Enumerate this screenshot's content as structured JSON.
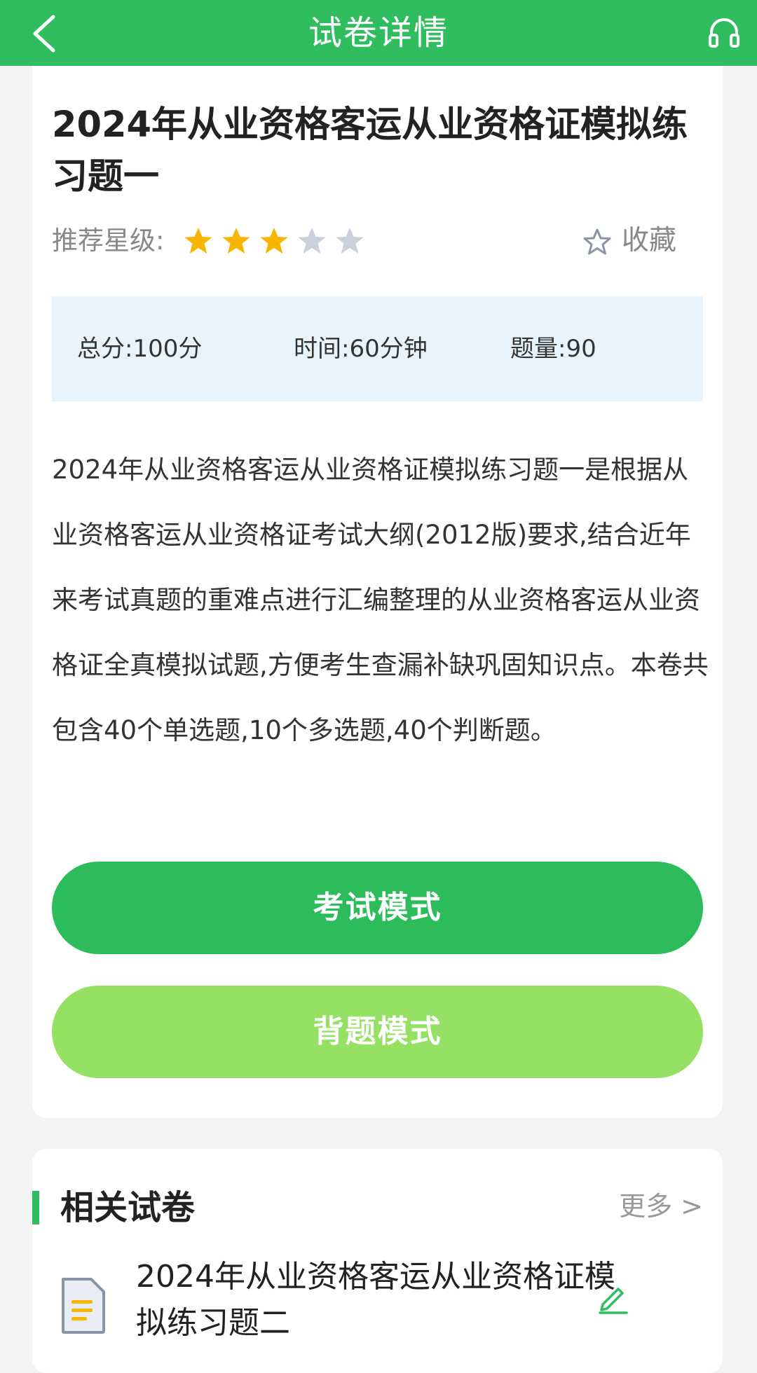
{
  "header": {
    "title": "试卷详情",
    "back_icon": "chevron-left-icon",
    "action_icon": "headset-icon"
  },
  "paper": {
    "title": "2024年从业资格客运从业资格证模拟练习题一",
    "rating_label": "推荐星级:",
    "rating": 3,
    "rating_max": 5,
    "favorite_label": "收藏",
    "stats": {
      "total_score": "总分:100分",
      "duration": "时间:60分钟",
      "question_count": "题量:90"
    },
    "description": "2024年从业资格客运从业资格证模拟练习题一是根据从业资格客运从业资格证考试大纲(2012版)要求,结合近年来考试真题的重难点进行汇编整理的从业资格客运从业资格证全真模拟试题,方便考生查漏补缺巩固知识点。本卷共包含40个单选题,10个多选题,40个判断题。"
  },
  "buttons": {
    "exam_mode": "考试模式",
    "memorize_mode": "背题模式"
  },
  "related": {
    "section_title": "相关试卷",
    "more_label": "更多 >",
    "items": [
      {
        "title": "2024年从业资格客运从业资格证模拟练习题二"
      }
    ]
  },
  "colors": {
    "brand": "#2fbd5f",
    "exam_button": "#2cbc5b",
    "memo_button": "#95e163",
    "star_active": "#f7b500",
    "star_inactive": "#c9d0db"
  }
}
